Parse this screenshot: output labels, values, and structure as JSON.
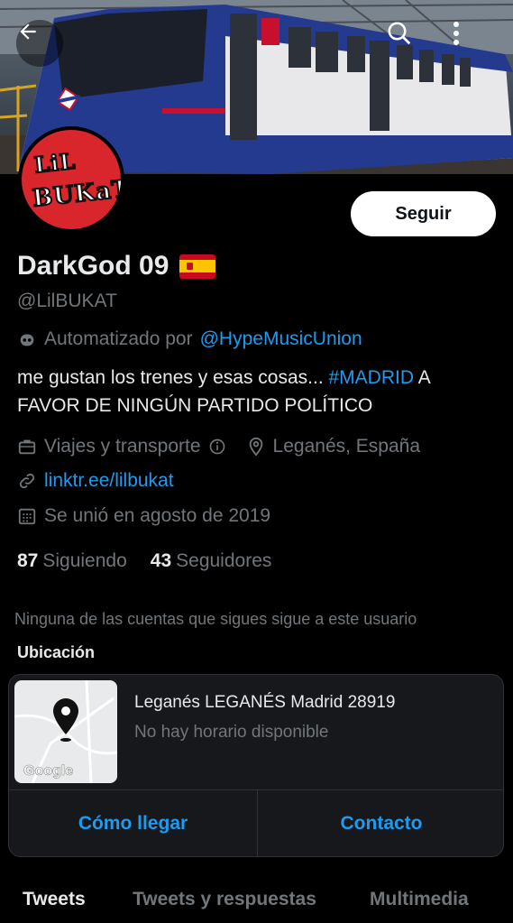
{
  "colors": {
    "background": "#000000",
    "text_primary": "#e7e9ea",
    "text_secondary": "#71767b",
    "accent": "#1d9bf0",
    "avatar_bg": "#d9262c"
  },
  "header": {
    "back_icon": "arrow-left-icon",
    "search_icon": "search-icon",
    "more_icon": "more-vertical-icon"
  },
  "avatar": {
    "logo_line1": "LiL",
    "logo_line2": "BUKaT"
  },
  "profile": {
    "follow_label": "Seguir",
    "name": "DarkGod 09",
    "flag": "spain-flag-icon",
    "handle": "@LilBUKAT",
    "automated_prefix": "Automatizado por",
    "automated_by": "@HypeMusicUnion",
    "bio_text": "me gustan los trenes y esas cosas... ",
    "bio_hashtag": "#MADRID",
    "bio_rest": " A FAVOR DE NINGÚN PARTIDO POLÍTICO",
    "category": "Viajes y transporte",
    "location": "Leganés, España",
    "website": "linktr.ee/lilbukat",
    "joined": "Se unió en agosto de 2019",
    "following_count": "87",
    "following_label": "Siguiendo",
    "followers_count": "43",
    "followers_label": "Seguidores",
    "followers_notice": "Ninguna de las cuentas que sigues sigue a este usuario"
  },
  "location_card": {
    "title": "Ubicación",
    "address": "Leganés LEGANÉS Madrid 28919",
    "hours": "No hay horario disponible",
    "map_label": "Google",
    "directions_label": "Cómo llegar",
    "contact_label": "Contacto"
  },
  "tabs": [
    {
      "label": "Tweets",
      "active": true
    },
    {
      "label": "Tweets y respuestas",
      "active": false
    },
    {
      "label": "Multimedia",
      "active": false
    }
  ]
}
